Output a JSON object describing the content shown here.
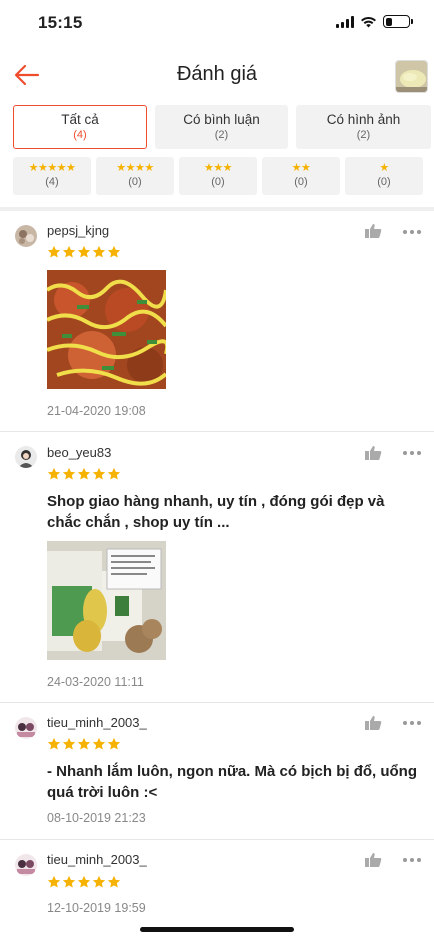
{
  "status": {
    "time": "15:15"
  },
  "header": {
    "title": "Đánh giá"
  },
  "filters": {
    "tabs": [
      {
        "label": "Tất cả",
        "count": "(4)"
      },
      {
        "label": "Có bình luận",
        "count": "(2)"
      },
      {
        "label": "Có hình ảnh",
        "count": "(2)"
      }
    ],
    "star_tabs": [
      {
        "stars": "★★★★★",
        "count": "(4)"
      },
      {
        "stars": "★★★★",
        "count": "(0)"
      },
      {
        "stars": "★★★",
        "count": "(0)"
      },
      {
        "stars": "★★",
        "count": "(0)"
      },
      {
        "stars": "★",
        "count": "(0)"
      }
    ]
  },
  "reviews": [
    {
      "username": "pepsj_kjng",
      "rating": 5,
      "text": "",
      "date": "21-04-2020 19:08"
    },
    {
      "username": "beo_yeu83",
      "rating": 5,
      "text": "Shop giao hàng nhanh, uy tín , đóng gói đẹp và chắc chắn , shop uy tín ...",
      "date": "24-03-2020 11:11"
    },
    {
      "username": "tieu_minh_2003_",
      "rating": 5,
      "text": "- Nhanh lắm luôn, ngon nữa. Mà có bịch bị đổ, uổng quá trời luôn :<",
      "date": "08-10-2019 21:23"
    },
    {
      "username": "tieu_minh_2003_",
      "rating": 5,
      "text": "",
      "date": "12-10-2019 19:59"
    }
  ],
  "colors": {
    "accent": "#ee4d2d",
    "star": "#f5b200"
  }
}
